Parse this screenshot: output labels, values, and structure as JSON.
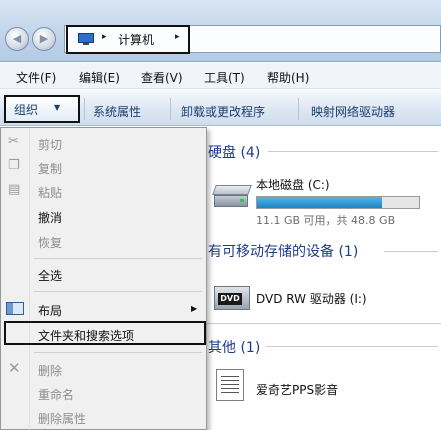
{
  "window": {
    "nav_back_glyph": "◀",
    "nav_forward_glyph": "▶",
    "address": {
      "path_separator": "▸",
      "location": "计算机"
    }
  },
  "menubar": {
    "items": [
      "文件(F)",
      "编辑(E)",
      "查看(V)",
      "工具(T)",
      "帮助(H)"
    ]
  },
  "commandbar": {
    "organize_label": "组织",
    "organize_arrow": "▼",
    "buttons": [
      "系统属性",
      "卸载或更改程序",
      "映射网络驱动器"
    ]
  },
  "dropdown": {
    "items": [
      {
        "label": "剪切",
        "enabled": false,
        "icon": "scissors-icon"
      },
      {
        "label": "复制",
        "enabled": false,
        "icon": "copy-icon"
      },
      {
        "label": "粘贴",
        "enabled": false,
        "icon": "paste-icon"
      },
      {
        "label": "撤消",
        "enabled": true
      },
      {
        "label": "恢复",
        "enabled": false
      },
      {
        "label": "全选",
        "enabled": true
      },
      {
        "label": "布局",
        "enabled": true,
        "icon": "layout-icon",
        "has_submenu": true
      },
      {
        "label": "文件夹和搜索选项",
        "enabled": true,
        "highlighted": true
      },
      {
        "label": "删除",
        "enabled": false,
        "icon": "delete-icon"
      },
      {
        "label": "重命名",
        "enabled": false
      },
      {
        "label": "删除属性",
        "enabled": false
      }
    ],
    "submenu_arrow": "▶"
  },
  "content": {
    "groups": [
      {
        "header": "硬盘 (4)",
        "items": [
          {
            "name": "本地磁盘 (C:)",
            "detail": "11.1 GB 可用，共 48.8 GB",
            "used_fraction": 0.77,
            "icon": "hard-drive-icon"
          }
        ]
      },
      {
        "header": "有可移动存储的设备 (1)",
        "items": [
          {
            "name": "DVD RW 驱动器 (I:)",
            "icon": "dvd-drive-icon",
            "badge": "DVD"
          }
        ]
      },
      {
        "header": "其他 (1)",
        "items": [
          {
            "name": "爱奇艺PPS影音",
            "icon": "app-shortcut-icon"
          }
        ]
      }
    ]
  },
  "colors": {
    "group_header": "#1e3a8a",
    "usage_bar": "#1d84c4",
    "highlight_border": "#111111"
  }
}
